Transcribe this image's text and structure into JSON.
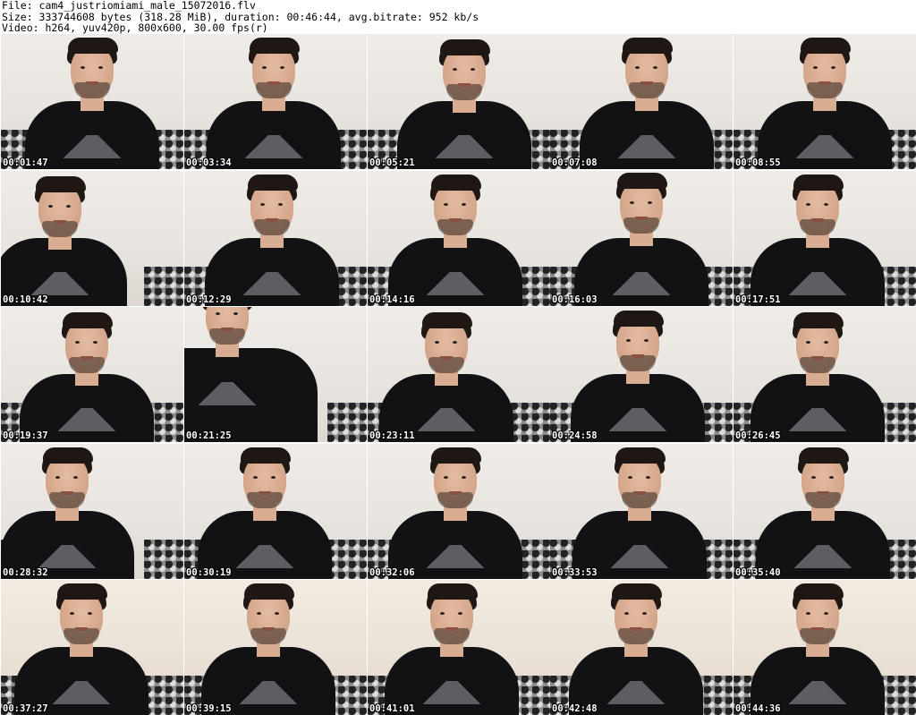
{
  "header": {
    "file_line": "File: cam4_justriomiami_male_15072016.flv",
    "size_line": "Size: 333744608 bytes (318.28 MiB), duration: 00:46:44, avg.bitrate: 952 kb/s",
    "video_line": "Video: h264, yuv420p, 800x600, 30.00 fps(r)"
  },
  "thumbnails": [
    {
      "time": "00:01:47"
    },
    {
      "time": "00:03:34"
    },
    {
      "time": "00:05:21"
    },
    {
      "time": "00:07:08"
    },
    {
      "time": "00:08:55"
    },
    {
      "time": "00:10:42"
    },
    {
      "time": "00:12:29"
    },
    {
      "time": "00:14:16"
    },
    {
      "time": "00:16:03"
    },
    {
      "time": "00:17:51"
    },
    {
      "time": "00:19:37"
    },
    {
      "time": "00:21:25"
    },
    {
      "time": "00:23:11"
    },
    {
      "time": "00:24:58"
    },
    {
      "time": "00:26:45"
    },
    {
      "time": "00:28:32"
    },
    {
      "time": "00:30:19"
    },
    {
      "time": "00:32:06"
    },
    {
      "time": "00:33:53"
    },
    {
      "time": "00:35:40"
    },
    {
      "time": "00:37:27"
    },
    {
      "time": "00:39:15"
    },
    {
      "time": "00:41:01"
    },
    {
      "time": "00:42:48"
    },
    {
      "time": "00:44:36"
    }
  ]
}
